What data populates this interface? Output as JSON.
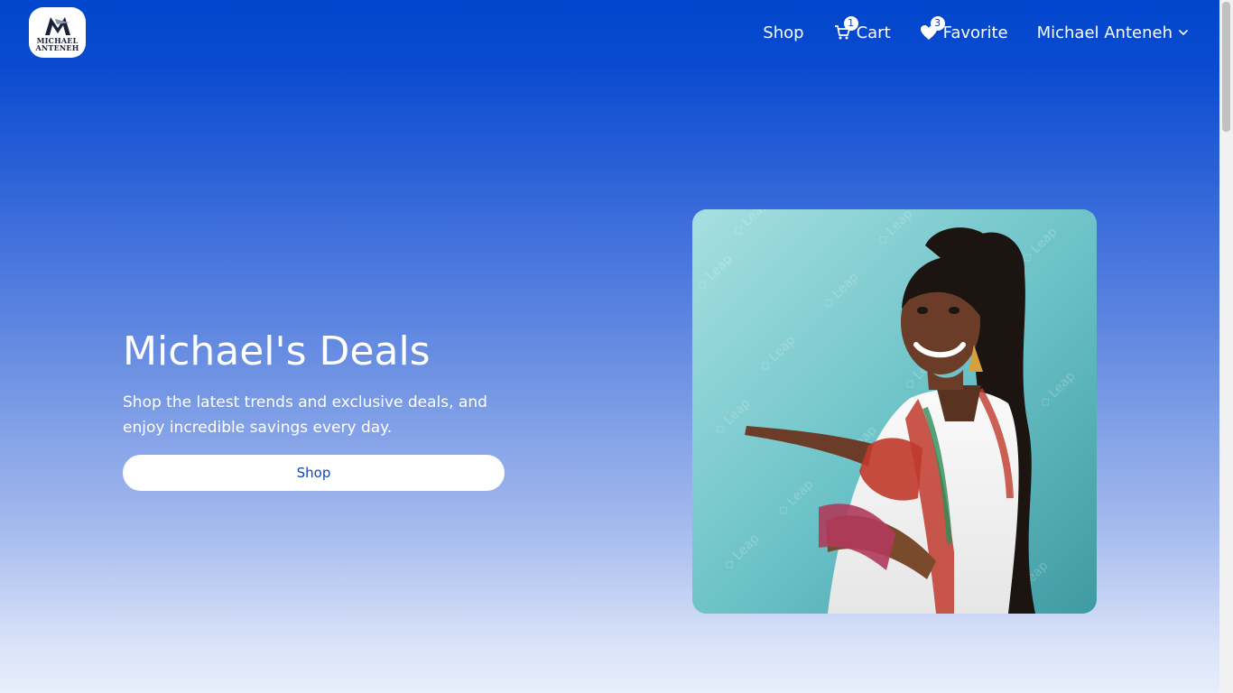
{
  "brand": {
    "logo_line1": "MICHAEL",
    "logo_line2": "ANTENEH",
    "logo_icon": "m-logo-icon"
  },
  "nav": {
    "shop_label": "Shop",
    "cart_label": "Cart",
    "cart_count": "1",
    "cart_icon": "cart-icon",
    "favorite_label": "Favorite",
    "favorite_count": "3",
    "favorite_icon": "heart-icon",
    "user_label": "Michael Anteneh",
    "user_menu_icon": "chevron-down-icon"
  },
  "hero": {
    "title": "Michael's Deals",
    "subtitle": "Shop the latest trends and exclusive deals, and enjoy incredible savings every day.",
    "button_label": "Shop",
    "image_watermark": "Leap"
  },
  "colors": {
    "nav_blue": "#0046cc",
    "button_text": "#0a44c4",
    "image_bg": "#6fc3c8"
  }
}
